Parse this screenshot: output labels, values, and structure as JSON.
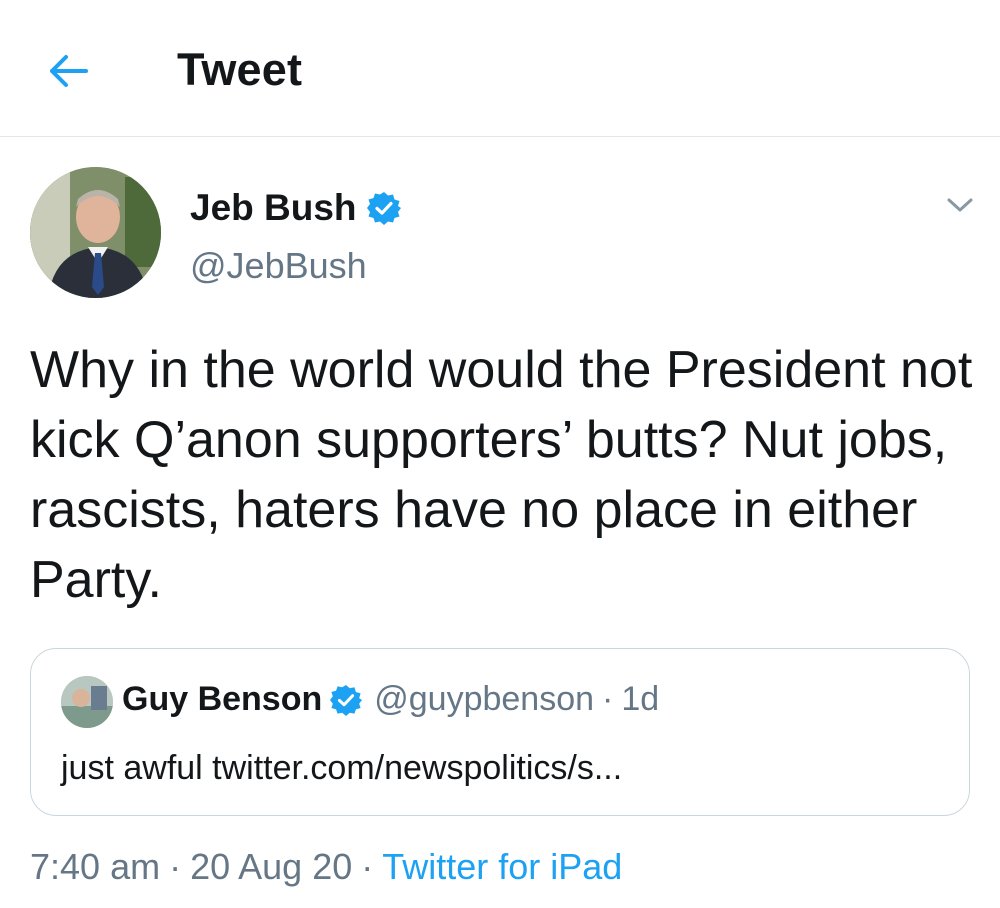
{
  "header": {
    "back_icon": "arrow-left-icon",
    "title": "Tweet"
  },
  "colors": {
    "accent": "#1da1f2",
    "text_primary": "#14171a",
    "text_secondary": "#657786",
    "border": "#e1e8ed"
  },
  "tweet": {
    "author": {
      "name": "Jeb Bush",
      "handle": "@JebBush",
      "verified": true
    },
    "text": "Why in the world would the President not kick Q’anon supporters’ butts? Nut jobs, rascists, haters have no place in either Party.",
    "quoted": {
      "name": "Guy Benson",
      "handle": "@guypbenson",
      "separator": "·",
      "time": "1d",
      "verified": true,
      "text": "just awful twitter.com/newspolitics/s..."
    },
    "meta": {
      "time": "7:40 am",
      "separator": "·",
      "date": "20 Aug 20",
      "source": "Twitter for iPad"
    }
  }
}
